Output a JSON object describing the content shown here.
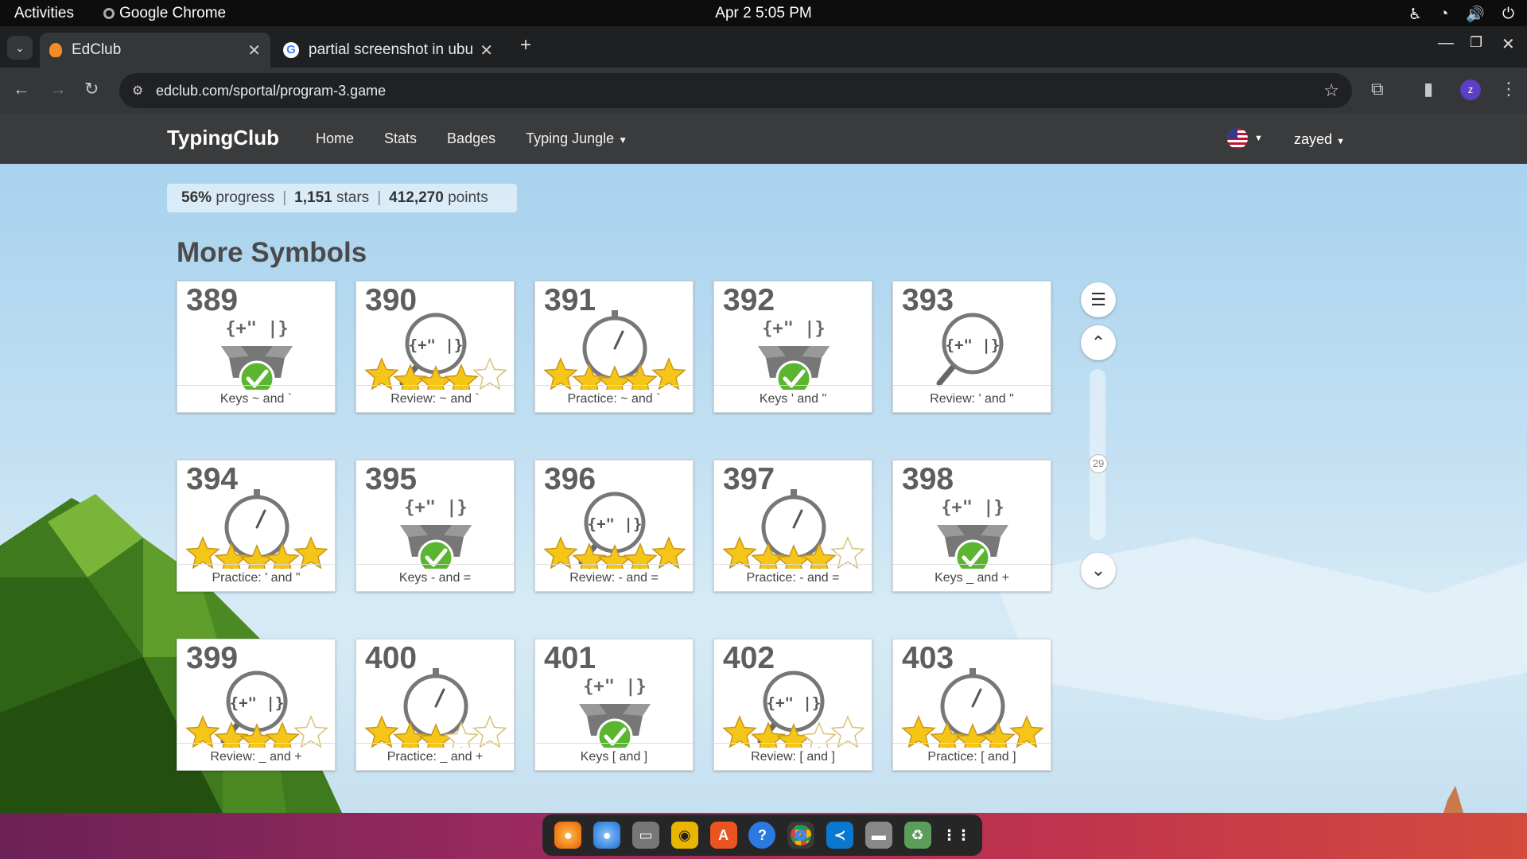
{
  "system_bar": {
    "activities": "Activities",
    "app": "Google Chrome",
    "clock": "Apr 2  5:05 PM"
  },
  "tabs": [
    {
      "title": "EdClub",
      "active": true
    },
    {
      "title": "partial screenshot in ubu",
      "active": false
    }
  ],
  "address_bar": {
    "url": "edclub.com/sportal/program-3.game",
    "profile_initial": "z"
  },
  "site_nav": {
    "brand": "TypingClub",
    "links": [
      "Home",
      "Stats",
      "Badges",
      "Typing Jungle"
    ],
    "user": "zayed"
  },
  "stats": {
    "progress_value": "56%",
    "progress_label": "progress",
    "stars_value": "1,151",
    "stars_label": "stars",
    "points_value": "412,270",
    "points_label": "points"
  },
  "section": {
    "title": "More Symbols"
  },
  "lessons": [
    {
      "number": "389",
      "label": "Keys ~ and `",
      "type": "keys",
      "stars": 0,
      "completed": true
    },
    {
      "number": "390",
      "label": "Review: ~ and `",
      "type": "review",
      "stars": 4,
      "completed": false
    },
    {
      "number": "391",
      "label": "Practice: ~ and `",
      "type": "practice",
      "stars": 5,
      "completed": false
    },
    {
      "number": "392",
      "label": "Keys ' and \"",
      "type": "keys",
      "stars": 0,
      "completed": true
    },
    {
      "number": "393",
      "label": "Review: ' and \"",
      "type": "review",
      "stars": 0,
      "completed": false
    },
    {
      "number": "394",
      "label": "Practice: ' and \"",
      "type": "practice",
      "stars": 5,
      "completed": false
    },
    {
      "number": "395",
      "label": "Keys - and =",
      "type": "keys",
      "stars": 0,
      "completed": true
    },
    {
      "number": "396",
      "label": "Review: - and =",
      "type": "review",
      "stars": 5,
      "completed": false
    },
    {
      "number": "397",
      "label": "Practice: - and =",
      "type": "practice",
      "stars": 4,
      "completed": false
    },
    {
      "number": "398",
      "label": "Keys _ and +",
      "type": "keys",
      "stars": 0,
      "completed": true
    },
    {
      "number": "399",
      "label": "Review: _ and +",
      "type": "review",
      "stars": 4,
      "completed": false
    },
    {
      "number": "400",
      "label": "Practice: _ and +",
      "type": "practice",
      "stars": 3,
      "completed": false
    },
    {
      "number": "401",
      "label": "Keys [ and ]",
      "type": "keys",
      "stars": 0,
      "completed": true
    },
    {
      "number": "402",
      "label": "Review: [ and ]",
      "type": "review",
      "stars": 3,
      "completed": false
    },
    {
      "number": "403",
      "label": "Practice: [ and ]",
      "type": "practice",
      "stars": 5,
      "completed": false
    }
  ],
  "scroller": {
    "position_label": "29"
  },
  "icon_glyph": "{+\" |}",
  "colors": {
    "star": "#f5c518",
    "check": "#5cb531",
    "nav_bg": "#3a3b3c",
    "card_number": "#5e5e5e"
  },
  "dock_apps": [
    "firefox-icon",
    "thunderbird-icon",
    "files-icon",
    "rhythmbox-icon",
    "app-center-icon",
    "help-icon",
    "chrome-icon",
    "vscode-icon",
    "disk-icon",
    "trash-icon",
    "app-grid-icon"
  ]
}
